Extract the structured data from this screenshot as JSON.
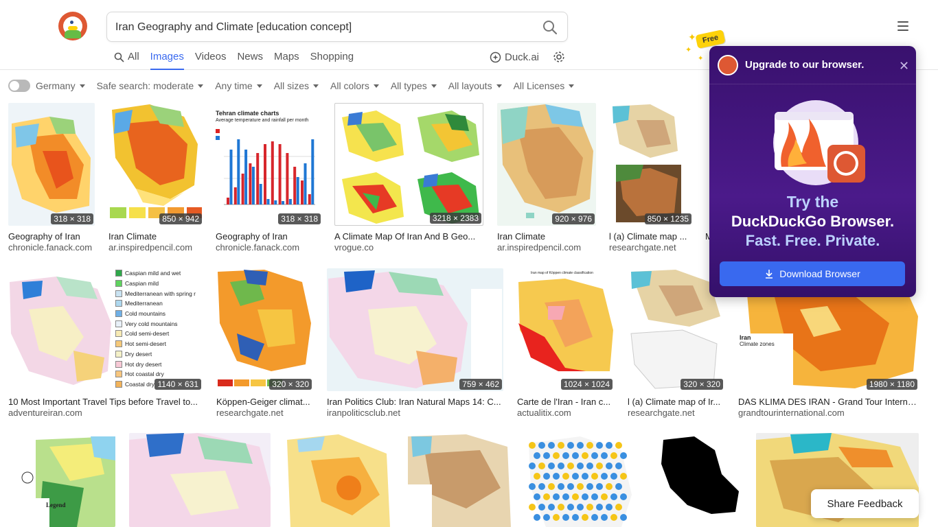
{
  "search": {
    "query": "Iran Geography and Climate [education concept]"
  },
  "tabs": [
    {
      "label": "All"
    },
    {
      "label": "Images"
    },
    {
      "label": "Videos"
    },
    {
      "label": "News"
    },
    {
      "label": "Maps"
    },
    {
      "label": "Shopping"
    }
  ],
  "duckai_label": "Duck.ai",
  "filters": {
    "region": "Germany",
    "safe_search": "Safe search: moderate",
    "time": "Any time",
    "size": "All sizes",
    "color": "All colors",
    "type": "All types",
    "layout": "All layouts",
    "license": "All Licenses"
  },
  "results": [
    {
      "title": "Geography of Iran",
      "source": "chronicle.fanack.com",
      "dims": "318 × 318"
    },
    {
      "title": "Iran Climate",
      "source": "ar.inspiredpencil.com",
      "dims": "850 × 942"
    },
    {
      "title": "Geography of Iran",
      "source": "chronicle.fanack.com",
      "dims": "318 × 318"
    },
    {
      "title": "A Climate Map Of Iran And B Geo...",
      "source": "vrogue.co",
      "dims": "3218 × 2383"
    },
    {
      "title": "Iran Climate",
      "source": "ar.inspiredpencil.com",
      "dims": "920 × 976"
    },
    {
      "title": "l (a) Climate map ...",
      "source": "researchgate.net",
      "dims": "850 × 1235"
    },
    {
      "title": "M",
      "source": "",
      "dims": ""
    },
    {
      "title": "10 Most Important Travel Tips before Travel to...",
      "source": "adventureiran.com",
      "dims": "1140 × 631"
    },
    {
      "title": "Köppen-Geiger climat...",
      "source": "researchgate.net",
      "dims": "320 × 320"
    },
    {
      "title": "Iran Politics Club: Iran Natural Maps 14: C...",
      "source": "iranpoliticsclub.net",
      "dims": "759 × 462"
    },
    {
      "title": "Carte de l'Iran - Iran c...",
      "source": "actualitix.com",
      "dims": "1024 × 1024"
    },
    {
      "title": "l (a) Climate map of Ir...",
      "source": "researchgate.net",
      "dims": "320 × 320"
    },
    {
      "title": "DAS KLIMA DES IRAN - Grand Tour Interna...",
      "source": "grandtourinternational.com",
      "dims": "1980 × 1180"
    }
  ],
  "thumb_text": {
    "tehran_title": "Tehran climate charts",
    "tehran_sub": "Average temperature and rainfall per month",
    "legend_items": [
      "Caspian mild and wet",
      "Caspian mild",
      "Mediterranean with spring r",
      "Mediterranean",
      "Cold mountains",
      "Very cold mountains",
      "Cold semi-desert",
      "Hot semi-desert",
      "Dry desert",
      "Hot dry desert",
      "Hot coastal dry",
      "Coastal dry"
    ],
    "climate_zones": "Climate zones",
    "iran_label": "Iran",
    "legend_label": "Legend",
    "koppen_title": "Iran map of Köppen climate classification"
  },
  "promo": {
    "free_badge": "Free",
    "title": "Upgrade to our browser.",
    "line1": "Try the",
    "line2": "DuckDuckGo Browser.",
    "line3": "Fast. Free. Private.",
    "button": "Download Browser"
  },
  "share_feedback": "Share Feedback",
  "colors": {
    "accent": "#3969ef",
    "duck_orange": "#de5833",
    "promo_bg": "#3f1378",
    "badge_yellow": "#fdd20a"
  }
}
